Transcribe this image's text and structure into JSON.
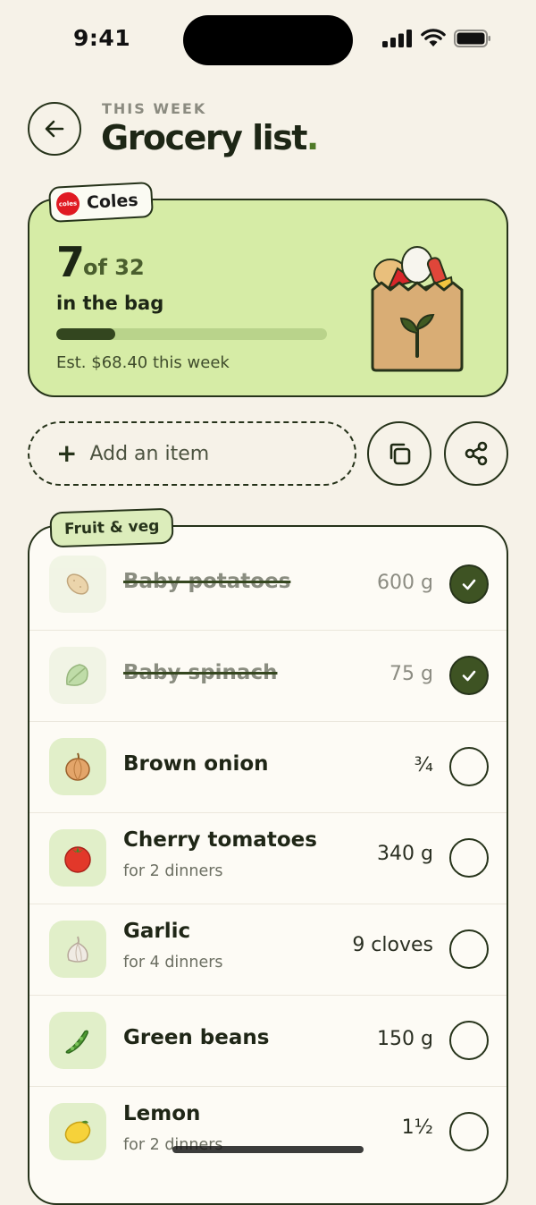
{
  "status_bar": {
    "time": "9:41",
    "icons": [
      "signal-icon",
      "wifi-icon",
      "battery-icon"
    ]
  },
  "header": {
    "eyebrow": "THIS WEEK",
    "title": "Grocery list",
    "title_dot": "."
  },
  "store": {
    "name": "Coles",
    "logo_text": "coles",
    "count_done": "7",
    "count_total_text": "of 32",
    "subtitle": "in the bag",
    "progress_fraction": 0.21875,
    "estimate": "Est. $68.40 this week",
    "brand_color": "#e01a22",
    "card_color": "#d6eca6"
  },
  "add_item": {
    "label": "Add an item",
    "icon": "plus-icon"
  },
  "actions": {
    "copy_icon": "copy-icon",
    "share_icon": "share-icon"
  },
  "section": {
    "title": "Fruit & veg",
    "items": [
      {
        "name": "Baby potatoes",
        "note": "",
        "qty": "600 g",
        "checked": true,
        "icon": "potato-icon"
      },
      {
        "name": "Baby spinach",
        "note": "",
        "qty": "75 g",
        "checked": true,
        "icon": "spinach-icon"
      },
      {
        "name": "Brown onion",
        "note": "",
        "qty": "¾",
        "checked": false,
        "icon": "onion-icon"
      },
      {
        "name": "Cherry tomatoes",
        "note": "for 2 dinners",
        "qty": "340 g",
        "checked": false,
        "icon": "tomato-icon"
      },
      {
        "name": "Garlic",
        "note": "for 4 dinners",
        "qty": "9 cloves",
        "checked": false,
        "icon": "garlic-icon"
      },
      {
        "name": "Green beans",
        "note": "",
        "qty": "150 g",
        "checked": false,
        "icon": "green-beans-icon"
      },
      {
        "name": "Lemon",
        "note": "for 2 dinners",
        "qty": "1½",
        "checked": false,
        "icon": "lemon-icon"
      }
    ]
  },
  "colors": {
    "accent_dark": "#3e5323",
    "outline": "#26331a",
    "background": "#f6f2e8"
  }
}
